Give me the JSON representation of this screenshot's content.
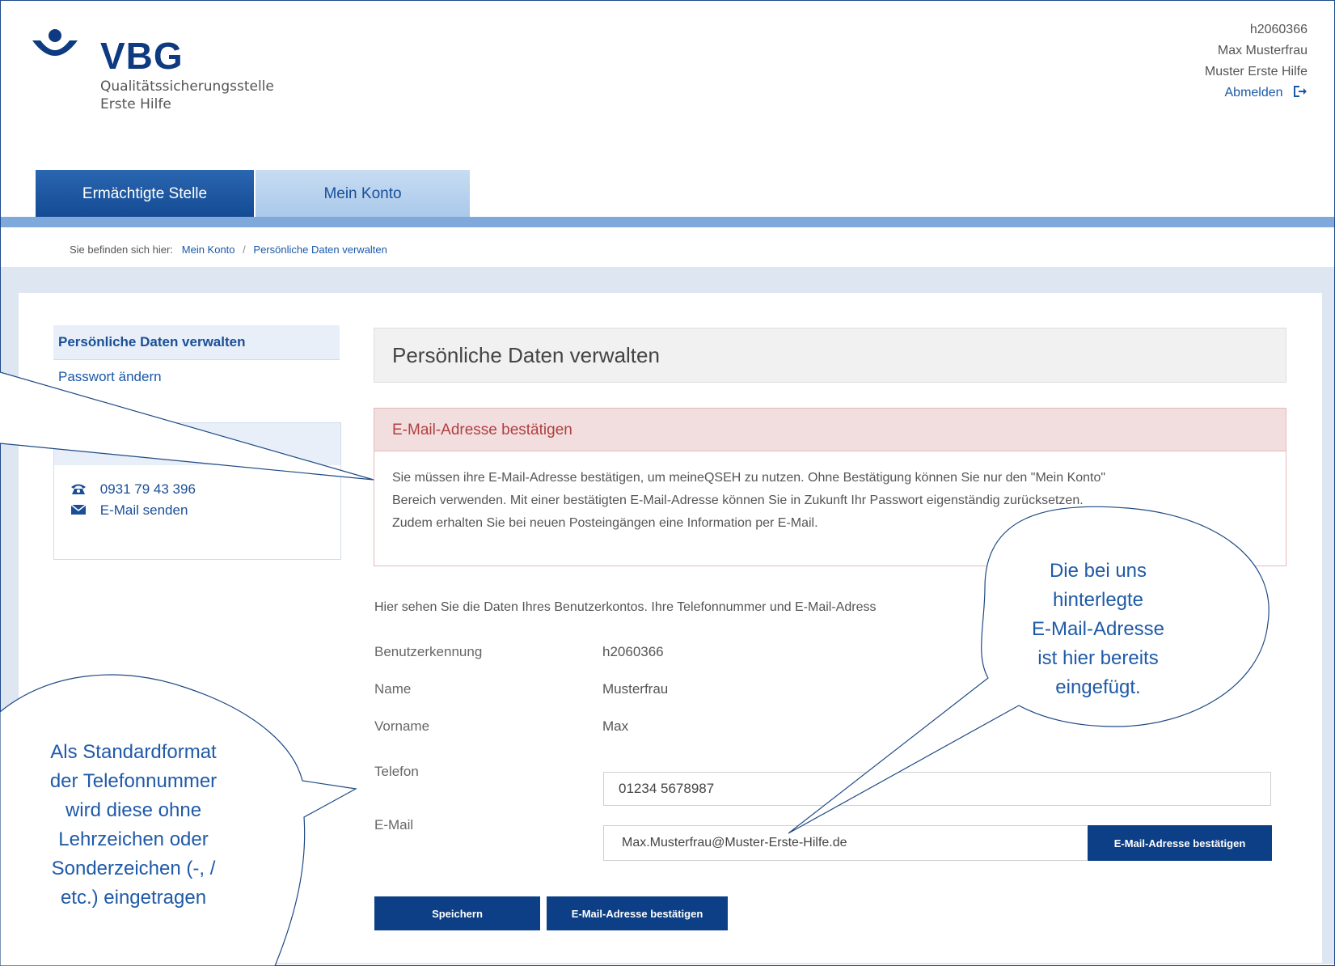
{
  "logo": {
    "name": "VBG",
    "line1": "Qualitätssicherungsstelle",
    "line2": "Erste Hilfe"
  },
  "user": {
    "id": "h2060366",
    "name": "Max Musterfrau",
    "org": "Muster Erste Hilfe",
    "logout": "Abmelden",
    "logout_icon": "logout-icon"
  },
  "tabs": [
    {
      "label": "Ermächtigte Stelle",
      "active": true
    },
    {
      "label": "Mein Konto",
      "active": false
    }
  ],
  "breadcrumb": {
    "prefix": "Sie befinden sich hier:",
    "items": [
      "Mein Konto",
      "Persönliche Daten verwalten"
    ],
    "separator": "/"
  },
  "sidebar": {
    "items": [
      {
        "label": "Persönliche Daten verwalten",
        "active": true
      },
      {
        "label": "Passwort ändern",
        "active": false
      }
    ]
  },
  "contact": {
    "phone": "0931 79 43 396",
    "phone_icon": "phone-icon",
    "email": "E-Mail senden",
    "email_icon": "envelope-icon"
  },
  "main": {
    "title": "Persönliche Daten verwalten",
    "alert": {
      "title": "E-Mail-Adresse bestätigen",
      "line1": "Sie müssen ihre E-Mail-Adresse bestätigen, um meineQSEH zu nutzen. Ohne Bestätigung können Sie nur den \"Mein Konto\"",
      "line2": "Bereich verwenden. Mit einer bestätigten E-Mail-Adresse können Sie in Zukunft Ihr Passwort eigenständig zurücksetzen.",
      "line3": "Zudem erhalten Sie bei neuen Posteingängen eine Information per E-Mail."
    },
    "intro": "Hier sehen Sie die Daten Ihres Benutzerkontos. Ihre Telefonnummer und E-Mail-Adress",
    "fields": {
      "username_label": "Benutzerkennung",
      "username_value": "h2060366",
      "name_label": "Name",
      "name_value": "Musterfrau",
      "firstname_label": "Vorname",
      "firstname_value": "Max",
      "phone_label": "Telefon",
      "phone_value": "01234 5678987",
      "email_label": "E-Mail",
      "email_value": "Max.Musterfrau@Muster-Erste-Hilfe.de"
    },
    "buttons": {
      "confirm_inline": "E-Mail-Adresse bestätigen",
      "save": "Speichern",
      "confirm": "E-Mail-Adresse bestätigen"
    }
  },
  "callouts": {
    "right": [
      "Die bei uns",
      "hinterlegte",
      "E-Mail-Adresse",
      "ist hier bereits",
      "eingefügt."
    ],
    "left": [
      "Als Standardformat",
      "der Telefonnummer",
      "wird diese ohne",
      "Lehrzeichen oder",
      "Sonderzeichen (-, /",
      "etc.) eingetragen"
    ]
  },
  "colors": {
    "brand": "#0c3f86",
    "tab_line": "#7fa8db",
    "alert_bg": "#f2dede",
    "callout_text": "#1f5aa8"
  }
}
